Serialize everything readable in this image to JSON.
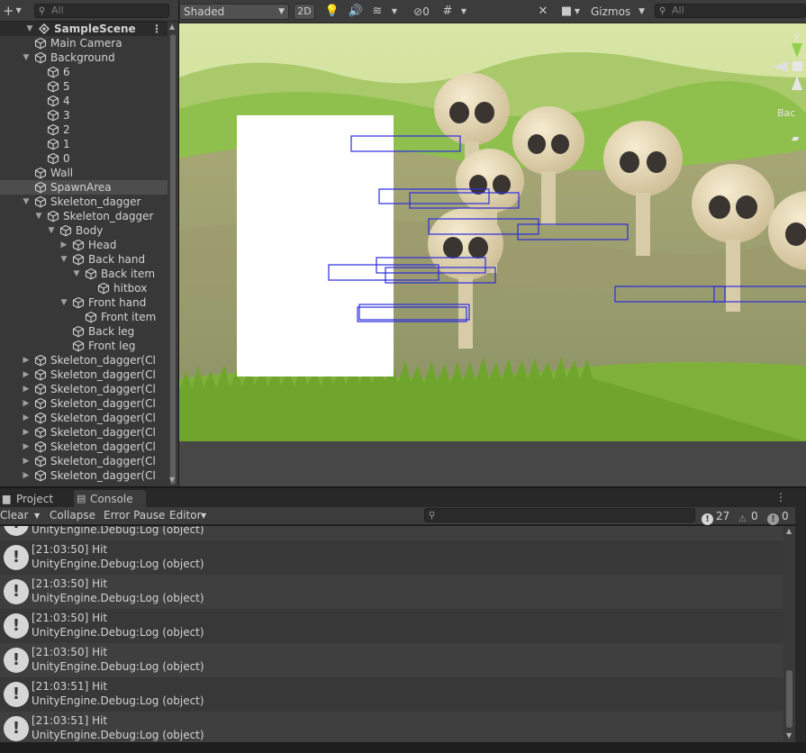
{
  "hierarchy": {
    "search_placeholder": "All",
    "rows": [
      {
        "label": "SampleScene",
        "depth": 0,
        "expander": "open",
        "icon": "scene-icon",
        "scene": true
      },
      {
        "label": "Main Camera",
        "depth": 1,
        "expander": "none",
        "icon": "cube-icon"
      },
      {
        "label": "Background",
        "depth": 1,
        "expander": "open",
        "icon": "cube-icon"
      },
      {
        "label": "6",
        "depth": 2,
        "expander": "none",
        "icon": "cube-icon"
      },
      {
        "label": "5",
        "depth": 2,
        "expander": "none",
        "icon": "cube-icon"
      },
      {
        "label": "4",
        "depth": 2,
        "expander": "none",
        "icon": "cube-icon"
      },
      {
        "label": "3",
        "depth": 2,
        "expander": "none",
        "icon": "cube-icon"
      },
      {
        "label": "2",
        "depth": 2,
        "expander": "none",
        "icon": "cube-icon"
      },
      {
        "label": "1",
        "depth": 2,
        "expander": "none",
        "icon": "cube-icon"
      },
      {
        "label": "0",
        "depth": 2,
        "expander": "none",
        "icon": "cube-icon"
      },
      {
        "label": "Wall",
        "depth": 1,
        "expander": "none",
        "icon": "cube-icon"
      },
      {
        "label": "SpawnArea",
        "depth": 1,
        "expander": "none",
        "icon": "cube-icon",
        "selected": true
      },
      {
        "label": "Skeleton_dagger",
        "depth": 1,
        "expander": "open",
        "icon": "cube-icon"
      },
      {
        "label": "Skeleton_dagger",
        "depth": 2,
        "expander": "open",
        "icon": "cube-icon"
      },
      {
        "label": "Body",
        "depth": 3,
        "expander": "open",
        "icon": "cube-icon"
      },
      {
        "label": "Head",
        "depth": 4,
        "expander": "closed",
        "icon": "cube-icon"
      },
      {
        "label": "Back hand",
        "depth": 4,
        "expander": "open",
        "icon": "cube-icon"
      },
      {
        "label": "Back item",
        "depth": 5,
        "expander": "open",
        "icon": "cube-icon"
      },
      {
        "label": "hitbox",
        "depth": 6,
        "expander": "none",
        "icon": "cube-icon"
      },
      {
        "label": "Front hand",
        "depth": 4,
        "expander": "open",
        "icon": "cube-icon"
      },
      {
        "label": "Front item",
        "depth": 5,
        "expander": "none",
        "icon": "cube-icon"
      },
      {
        "label": "Back leg",
        "depth": 4,
        "expander": "none",
        "icon": "cube-icon"
      },
      {
        "label": "Front leg",
        "depth": 4,
        "expander": "none",
        "icon": "cube-icon"
      },
      {
        "label": "Skeleton_dagger(Cl",
        "depth": 1,
        "expander": "closed",
        "icon": "cube-icon"
      },
      {
        "label": "Skeleton_dagger(Cl",
        "depth": 1,
        "expander": "closed",
        "icon": "cube-icon"
      },
      {
        "label": "Skeleton_dagger(Cl",
        "depth": 1,
        "expander": "closed",
        "icon": "cube-icon"
      },
      {
        "label": "Skeleton_dagger(Cl",
        "depth": 1,
        "expander": "closed",
        "icon": "cube-icon"
      },
      {
        "label": "Skeleton_dagger(Cl",
        "depth": 1,
        "expander": "closed",
        "icon": "cube-icon"
      },
      {
        "label": "Skeleton_dagger(Cl",
        "depth": 1,
        "expander": "closed",
        "icon": "cube-icon"
      },
      {
        "label": "Skeleton_dagger(Cl",
        "depth": 1,
        "expander": "closed",
        "icon": "cube-icon"
      },
      {
        "label": "Skeleton_dagger(Cl",
        "depth": 1,
        "expander": "closed",
        "icon": "cube-icon"
      },
      {
        "label": "Skeleton_dagger(Cl",
        "depth": 1,
        "expander": "closed",
        "icon": "cube-icon"
      }
    ]
  },
  "scene": {
    "shading_mode": "Shaded",
    "mode_2d": "2D",
    "hidden_count": "0",
    "gizmos_label": "Gizmos",
    "search_placeholder": "All",
    "axis_y": "y",
    "overlay_label": "Bac"
  },
  "bottom": {
    "tabs": [
      {
        "label": "Project",
        "icon": "folder-icon",
        "active": false
      },
      {
        "label": "Console",
        "icon": "console-icon",
        "active": true
      }
    ],
    "toolbar": {
      "clear": "Clear",
      "collapse": "Collapse",
      "error_pause": "Error Pause",
      "editor": "Editor"
    },
    "counts": {
      "info": "27",
      "warning": "0",
      "error": "0"
    },
    "logs": [
      {
        "line1": "",
        "line2": "UnityEngine.Debug:Log (object)",
        "partial": true
      },
      {
        "line1": "[21:03:50] Hit",
        "line2": "UnityEngine.Debug:Log (object)"
      },
      {
        "line1": "[21:03:50] Hit",
        "line2": "UnityEngine.Debug:Log (object)"
      },
      {
        "line1": "[21:03:50] Hit",
        "line2": "UnityEngine.Debug:Log (object)"
      },
      {
        "line1": "[21:03:50] Hit",
        "line2": "UnityEngine.Debug:Log (object)"
      },
      {
        "line1": "[21:03:51] Hit",
        "line2": "UnityEngine.Debug:Log (object)"
      },
      {
        "line1": "[21:03:51] Hit",
        "line2": "UnityEngine.Debug:Log (object)"
      }
    ]
  },
  "colors": {
    "panel_bg": "#383838",
    "selection": "#4d4d4d",
    "collider_outline": "#2c2ce0",
    "spawn_area": "#ffffff"
  }
}
